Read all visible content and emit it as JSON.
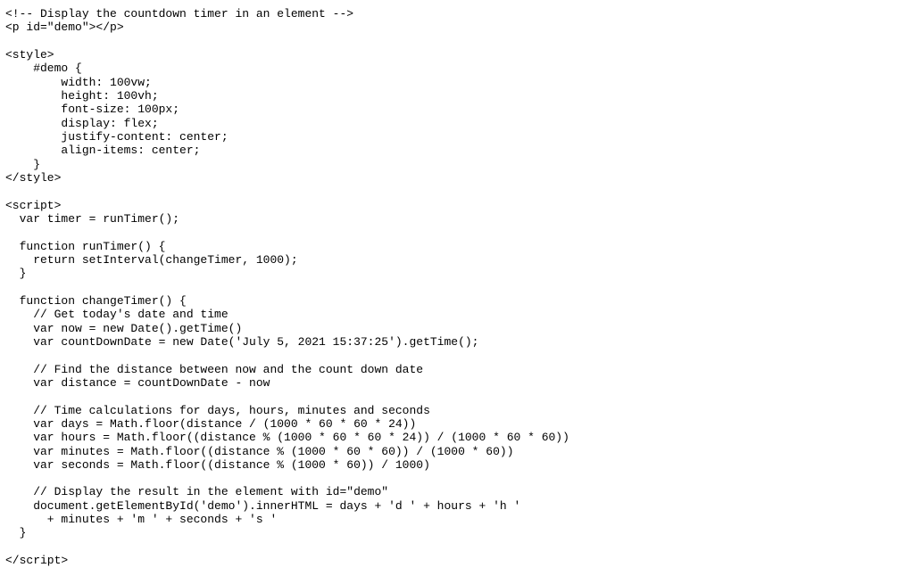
{
  "code": {
    "lines": [
      "<!-- Display the countdown timer in an element -->",
      "<p id=\"demo\"></p>",
      "",
      "<style>",
      "    #demo {",
      "        width: 100vw;",
      "        height: 100vh;",
      "        font-size: 100px;",
      "        display: flex;",
      "        justify-content: center;",
      "        align-items: center;",
      "    }",
      "</style>",
      "",
      "<script>",
      "  var timer = runTimer();",
      "",
      "  function runTimer() {",
      "    return setInterval(changeTimer, 1000);",
      "  }",
      "",
      "  function changeTimer() {",
      "    // Get today's date and time",
      "    var now = new Date().getTime()",
      "    var countDownDate = new Date('July 5, 2021 15:37:25').getTime();",
      "",
      "    // Find the distance between now and the count down date",
      "    var distance = countDownDate - now",
      "",
      "    // Time calculations for days, hours, minutes and seconds",
      "    var days = Math.floor(distance / (1000 * 60 * 60 * 24))",
      "    var hours = Math.floor((distance % (1000 * 60 * 60 * 24)) / (1000 * 60 * 60))",
      "    var minutes = Math.floor((distance % (1000 * 60 * 60)) / (1000 * 60))",
      "    var seconds = Math.floor((distance % (1000 * 60)) / 1000)",
      "",
      "    // Display the result in the element with id=\"demo\"",
      "    document.getElementById('demo').innerHTML = days + 'd ' + hours + 'h '",
      "      + minutes + 'm ' + seconds + 's '",
      "  }",
      "",
      "</script>"
    ]
  }
}
